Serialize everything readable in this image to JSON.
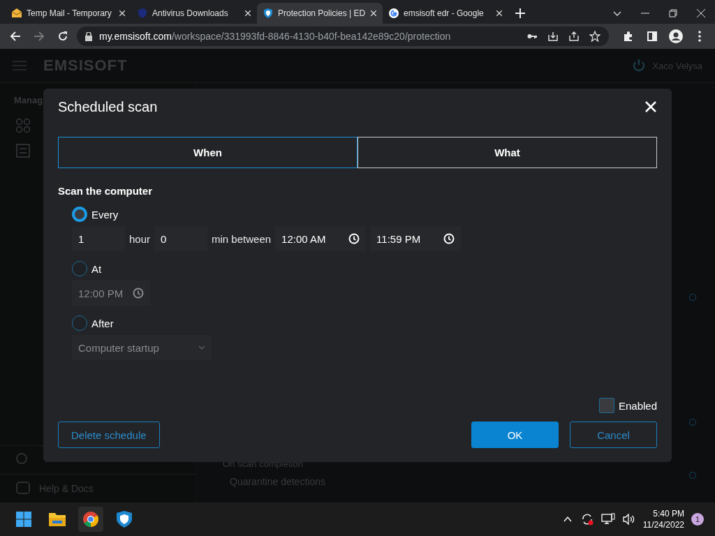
{
  "browser": {
    "tabs": [
      {
        "title": "Temp Mail - Temporary",
        "kind": "mail",
        "selected": false
      },
      {
        "title": "Antivirus Downloads",
        "kind": "brand",
        "selected": false
      },
      {
        "title": "Protection Policies | ED",
        "kind": "shield",
        "selected": true
      },
      {
        "title": "emsisoft edr - Google",
        "kind": "google",
        "selected": false
      }
    ],
    "url_host": "my.emsisoft.com",
    "url_path": "/workspace/331993fd-8846-4130-b40f-bea142e89c20/protection"
  },
  "app": {
    "logo": "EMSISOFT",
    "user": "Xaco Velysa",
    "sidebar_heading": "Manag",
    "help": "Help & Docs",
    "main_label": "On scan completion",
    "main_value": "Quarantine detections"
  },
  "dialog": {
    "title": "Scheduled scan",
    "tabs": [
      {
        "label": "When",
        "selected": true
      },
      {
        "label": "What",
        "selected": false
      }
    ],
    "section": "Scan the computer",
    "options": [
      {
        "kind": "every",
        "label": "Every",
        "selected": true,
        "hours": "1",
        "hour_label": "hour",
        "minutes": "0",
        "between_label": "min between",
        "from": "12:00 AM",
        "to": "11:59 PM"
      },
      {
        "kind": "at",
        "label": "At",
        "selected": false,
        "time": "12:00 PM"
      },
      {
        "kind": "after",
        "label": "After",
        "selected": false,
        "value": "Computer startup"
      }
    ],
    "enabled": {
      "label": "Enabled",
      "checked": false
    },
    "delete_button": "Delete schedule",
    "ok_button": "OK",
    "cancel_button": "Cancel"
  },
  "taskbar": {
    "time": "5:40 PM",
    "date": "11/24/2022",
    "notifications": "1"
  }
}
